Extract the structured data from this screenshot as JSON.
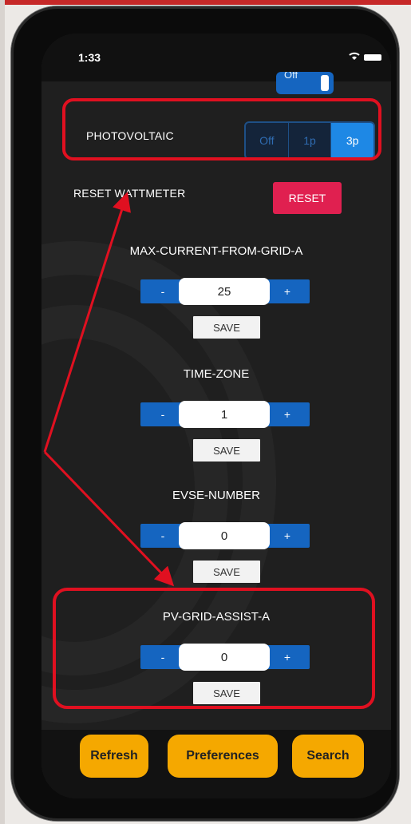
{
  "status_bar": {
    "time": "1:33"
  },
  "top_toggle": {
    "label": "Off"
  },
  "photovoltaic": {
    "label": "PHOTOVOLTAIC",
    "options": [
      "Off",
      "1p",
      "3p"
    ],
    "selected": "3p"
  },
  "reset_wattmeter": {
    "label": "RESET WATTMETER",
    "button": "RESET"
  },
  "settings": [
    {
      "title": "MAX-CURRENT-FROM-GRID-A",
      "value": "25",
      "minus": "-",
      "plus": "+",
      "save": "SAVE"
    },
    {
      "title": "TIME-ZONE",
      "value": "1",
      "minus": "-",
      "plus": "+",
      "save": "SAVE"
    },
    {
      "title": "EVSE-NUMBER",
      "value": "0",
      "minus": "-",
      "plus": "+",
      "save": "SAVE"
    },
    {
      "title": "PV-GRID-ASSIST-A",
      "value": "0",
      "minus": "-",
      "plus": "+",
      "save": "SAVE"
    }
  ],
  "footer": {
    "refresh": "Refresh",
    "preferences": "Preferences",
    "search": "Search"
  },
  "colors": {
    "accent_blue": "#1565c0",
    "selected_segment": "#1e88e5",
    "reset_red": "#e02050",
    "footer_orange": "#f5a800",
    "annotation_red": "#e01020"
  },
  "icons": {
    "wifi": "wifi-icon",
    "battery": "battery-icon"
  }
}
